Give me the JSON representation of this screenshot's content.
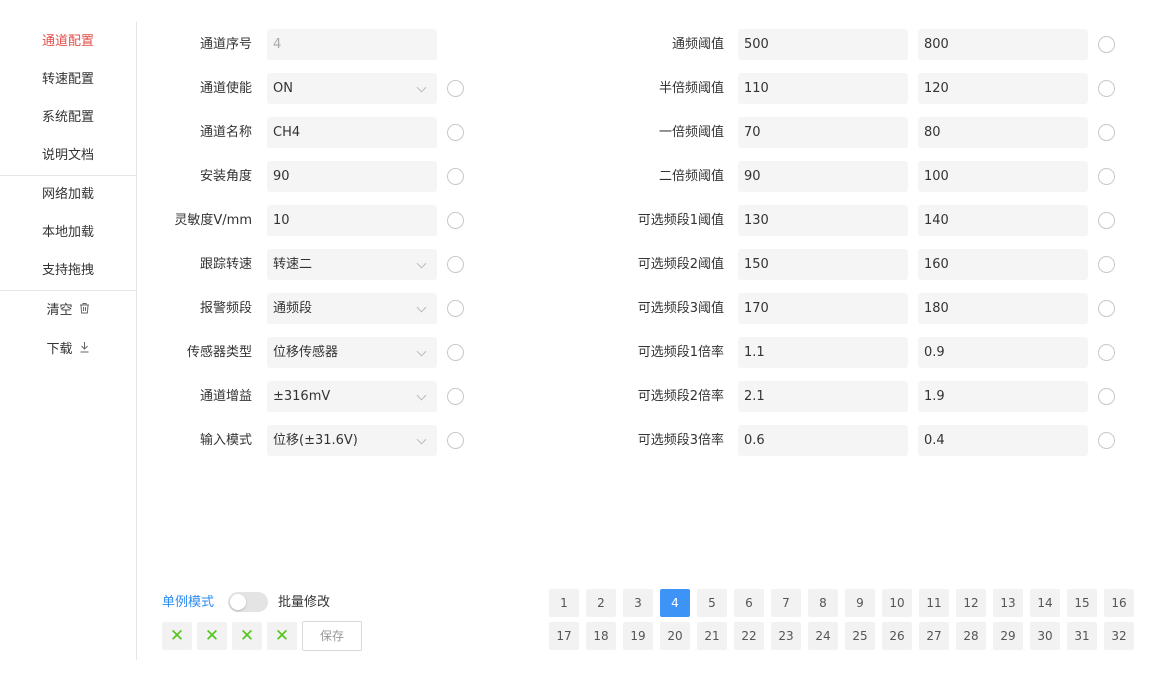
{
  "sidebar": {
    "items": [
      {
        "label": "通道配置",
        "active": true
      },
      {
        "label": "转速配置"
      },
      {
        "label": "系统配置"
      },
      {
        "label": "说明文档"
      },
      {
        "label": "网络加载"
      },
      {
        "label": "本地加载"
      },
      {
        "label": "支持拖拽"
      },
      {
        "label": "清空",
        "icon": "trash-icon"
      },
      {
        "label": "下载",
        "icon": "download-icon"
      }
    ]
  },
  "left_form": [
    {
      "label": "通道序号",
      "value": "4"
    },
    {
      "label": "通道使能",
      "value": "ON"
    },
    {
      "label": "通道名称",
      "value": "CH4"
    },
    {
      "label": "安装角度",
      "value": "90"
    },
    {
      "label": "灵敏度V/mm",
      "value": "10"
    },
    {
      "label": "跟踪转速",
      "value": "转速二"
    },
    {
      "label": "报警频段",
      "value": "通频段"
    },
    {
      "label": "传感器类型",
      "value": "位移传感器"
    },
    {
      "label": "通道增益",
      "value": "±316mV"
    },
    {
      "label": "输入模式",
      "value": "位移(±31.6V)"
    }
  ],
  "right_form": [
    {
      "label": "通频阈值",
      "value1": "500",
      "value2": "800"
    },
    {
      "label": "半倍频阈值",
      "value1": "110",
      "value2": "120"
    },
    {
      "label": "一倍频阈值",
      "value1": "70",
      "value2": "80"
    },
    {
      "label": "二倍频阈值",
      "value1": "90",
      "value2": "100"
    },
    {
      "label": "可选频段1阈值",
      "value1": "130",
      "value2": "140"
    },
    {
      "label": "可选频段2阈值",
      "value1": "150",
      "value2": "160"
    },
    {
      "label": "可选频段3阈值",
      "value1": "170",
      "value2": "180"
    },
    {
      "label": "可选频段1倍率",
      "value1": "1.1",
      "value2": "0.9"
    },
    {
      "label": "可选频段2倍率",
      "value1": "2.1",
      "value2": "1.9"
    },
    {
      "label": "可选频段3倍率",
      "value1": "0.6",
      "value2": "0.4"
    }
  ],
  "bottom": {
    "mode_single": "单例模式",
    "mode_batch": "批量修改",
    "x_buttons": [
      "✕",
      "✕",
      "✕",
      "✕"
    ],
    "save_label": "保存"
  },
  "pages": [
    "1",
    "2",
    "3",
    "4",
    "5",
    "6",
    "7",
    "8",
    "9",
    "10",
    "11",
    "12",
    "13",
    "14",
    "15",
    "16",
    "17",
    "18",
    "19",
    "20",
    "21",
    "22",
    "23",
    "24",
    "25",
    "26",
    "27",
    "28",
    "29",
    "30",
    "31",
    "32"
  ],
  "active_page": "4",
  "colors": {
    "accent_red": "#e2504c",
    "accent_blue": "#3d94f6",
    "link_blue": "#2d8cf0",
    "check_green": "#52c41a"
  }
}
